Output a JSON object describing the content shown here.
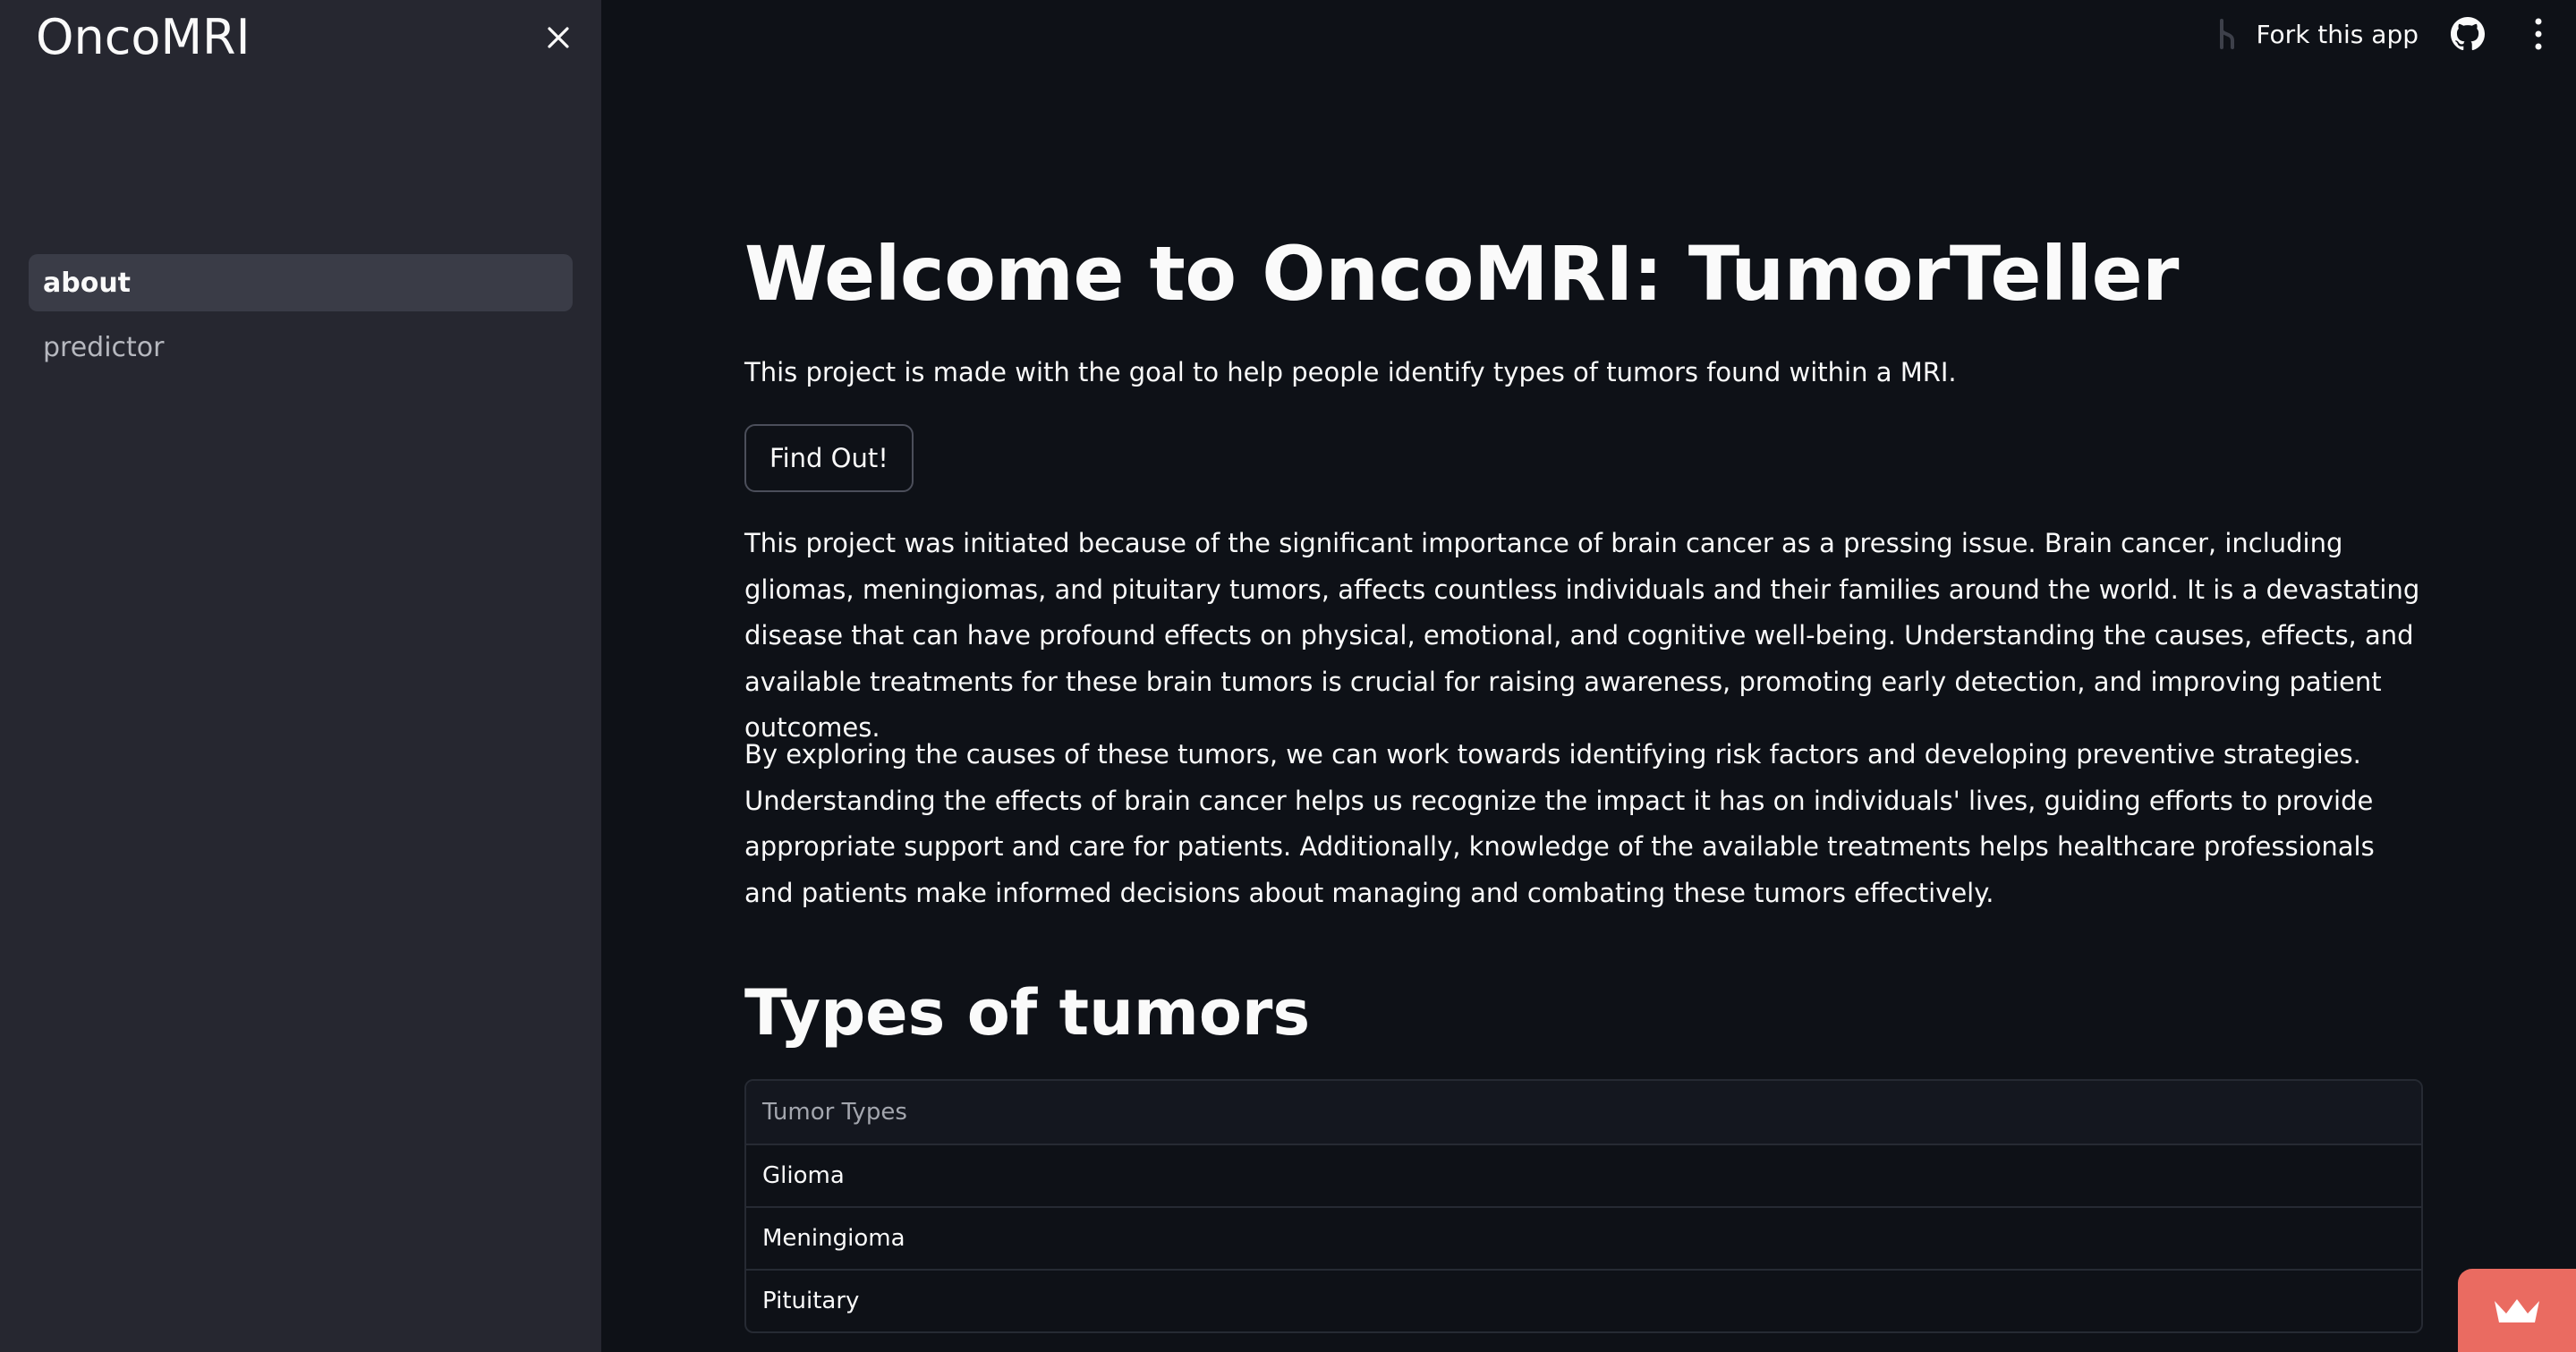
{
  "sidebar": {
    "brand": "OncoMRI",
    "items": [
      {
        "label": "about",
        "active": true
      },
      {
        "label": "predictor",
        "active": false
      }
    ]
  },
  "toolbar": {
    "fork_label": "Fork this app",
    "icons": [
      "fork-icon",
      "github-icon",
      "kebab-menu-icon"
    ]
  },
  "main": {
    "title": "Welcome to OncoMRI: TumorTeller",
    "intro": "This project is made with the goal to help people identify types of tumors found within a MRI.",
    "button_label": "Find Out!",
    "paragraph1": "This project was initiated because of the significant importance of brain cancer as a pressing issue. Brain cancer, including gliomas, meningiomas, and pituitary tumors, affects countless individuals and their families around the world. It is a devastating disease that can have profound effects on physical, emotional, and cognitive well-being. Understanding the causes, effects, and available treatments for these brain tumors is crucial for raising awareness, promoting early detection, and improving patient outcomes.",
    "paragraph2": "By exploring the causes of these tumors, we can work towards identifying risk factors and developing preventive strategies. Understanding the effects of brain cancer helps us recognize the impact it has on individuals' lives, guiding efforts to provide appropriate support and care for patients. Additionally, knowledge of the available treatments helps healthcare professionals and patients make informed decisions about managing and combating these tumors effectively.",
    "section_title": "Types of tumors",
    "table": {
      "header": "Tumor Types",
      "rows": [
        "Glioma",
        "Meningioma",
        "Pituitary"
      ]
    }
  },
  "colors": {
    "background": "#0e1117",
    "sidebar": "#262730",
    "text": "#fafafa",
    "badge": "#ea6b61"
  }
}
